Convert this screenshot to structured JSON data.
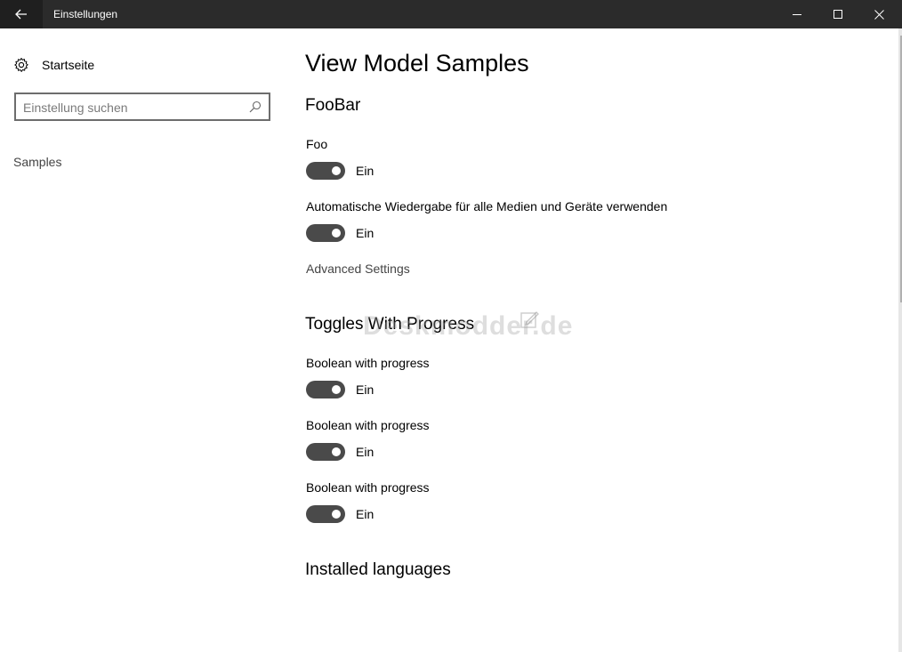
{
  "window": {
    "title": "Einstellungen"
  },
  "nav": {
    "home_label": "Startseite",
    "search_placeholder": "Einstellung suchen",
    "search_value": "",
    "items": [
      {
        "label": "Samples"
      }
    ]
  },
  "main": {
    "page_title": "View Model Samples",
    "sections": [
      {
        "title": "FooBar",
        "settings": [
          {
            "label": "Foo",
            "state": "Ein"
          },
          {
            "label": "Automatische Wiedergabe für alle Medien und Geräte verwenden",
            "state": "Ein"
          }
        ],
        "link": "Advanced Settings"
      },
      {
        "title": "Toggles With Progress",
        "settings": [
          {
            "label": "Boolean with progress",
            "state": "Ein"
          },
          {
            "label": "Boolean with progress",
            "state": "Ein"
          },
          {
            "label": "Boolean with progress",
            "state": "Ein"
          }
        ]
      },
      {
        "title": "Installed languages"
      }
    ]
  },
  "watermark": "Deskmodder.de",
  "colors": {
    "titlebar": "#2b2b2b",
    "toggle_on": "#4a4a4a",
    "background": "#ffffff"
  },
  "icons": {
    "back": "back-arrow-icon",
    "minimize": "minimize-icon",
    "maximize": "maximize-icon",
    "close": "close-icon",
    "home": "gear-icon",
    "search": "search-icon"
  }
}
